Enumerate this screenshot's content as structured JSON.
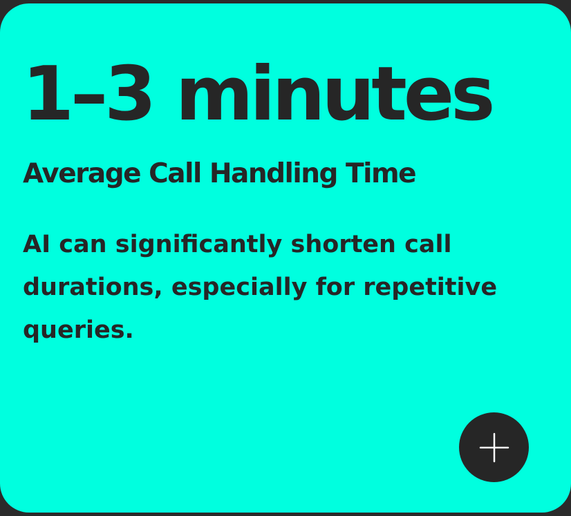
{
  "card": {
    "stat_value": "1–3 minutes",
    "title": "Average Call Handling Time",
    "description": "AI can significantly shorten call durations, especially for repetitive queries.",
    "background_color": "#00ffdf",
    "text_color": "#262626"
  },
  "expand_button": {
    "icon": "plus-icon",
    "background_color": "#262626",
    "icon_color": "#ffffff"
  },
  "page": {
    "background_color": "#2b2b2b"
  }
}
